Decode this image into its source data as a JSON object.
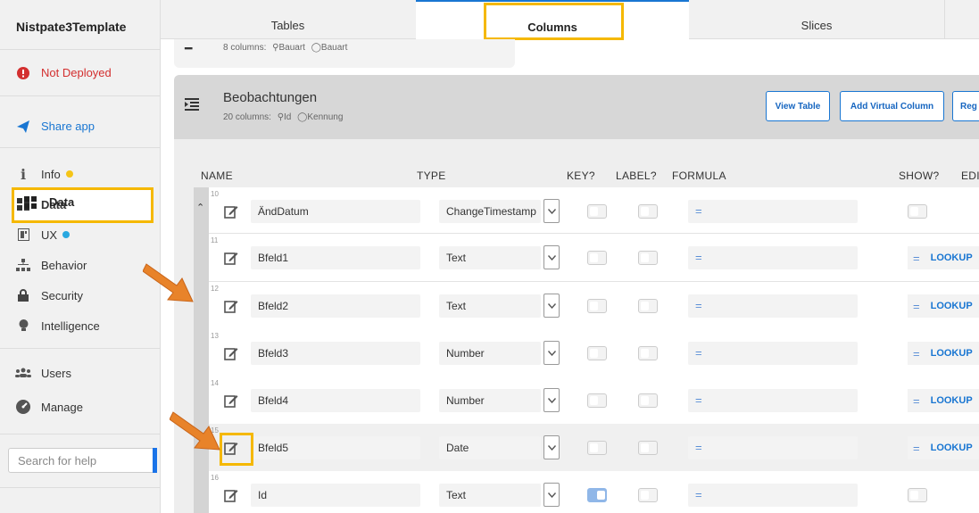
{
  "app": {
    "title": "Nistpate3Template"
  },
  "sidebar": {
    "status": "Not Deployed",
    "share": "Share app",
    "items": [
      {
        "label": "Info",
        "icon": "info-icon",
        "dot": "#f5c518"
      },
      {
        "label": "Data",
        "icon": "grid-icon"
      },
      {
        "label": "UX",
        "icon": "ux-icon",
        "dot": "#29a8e0"
      },
      {
        "label": "Behavior",
        "icon": "hierarchy-icon"
      },
      {
        "label": "Security",
        "icon": "lock-icon"
      },
      {
        "label": "Intelligence",
        "icon": "bulb-icon"
      }
    ],
    "users": "Users",
    "manage": "Manage",
    "search_placeholder": "Search for help"
  },
  "tabs": [
    {
      "label": "Tables"
    },
    {
      "label": "Columns",
      "active": true
    },
    {
      "label": "Slices"
    }
  ],
  "prev_table": {
    "meta": "8 columns:",
    "key": "Bauart",
    "label": "Bauart"
  },
  "table": {
    "name": "Beobachtungen",
    "meta": "20 columns:",
    "key": "Id",
    "label": "Kennung",
    "buttons": {
      "view": "View Table",
      "add_virtual": "Add Virtual Column",
      "regen": "Reg"
    }
  },
  "columns_header": {
    "name": "NAME",
    "type": "TYPE",
    "key": "KEY?",
    "label": "LABEL?",
    "formula": "FORMULA",
    "show": "SHOW?",
    "edit": "EDI"
  },
  "rows": [
    {
      "num": "10",
      "name": "ÄndDatum",
      "type": "ChangeTimestamp",
      "key": false,
      "label": false,
      "show": "toggle"
    },
    {
      "num": "11",
      "name": "Bfeld1",
      "type": "Text",
      "key": false,
      "label": false,
      "show": "LOOKUP"
    },
    {
      "num": "12",
      "name": "Bfeld2",
      "type": "Text",
      "key": false,
      "label": false,
      "show": "LOOKUP"
    },
    {
      "num": "13",
      "name": "Bfeld3",
      "type": "Number",
      "key": false,
      "label": false,
      "show": "LOOKUP"
    },
    {
      "num": "14",
      "name": "Bfeld4",
      "type": "Number",
      "key": false,
      "label": false,
      "show": "LOOKUP"
    },
    {
      "num": "15",
      "name": "Bfeld5",
      "type": "Date",
      "key": false,
      "label": false,
      "show": "LOOKUP"
    },
    {
      "num": "16",
      "name": "Id",
      "type": "Text",
      "key": true,
      "label": false,
      "show": "toggle"
    }
  ],
  "colors": {
    "accent": "#1976d2",
    "highlight": "#f5b800",
    "arrow": "#e8832a",
    "error": "#d32f2f"
  }
}
